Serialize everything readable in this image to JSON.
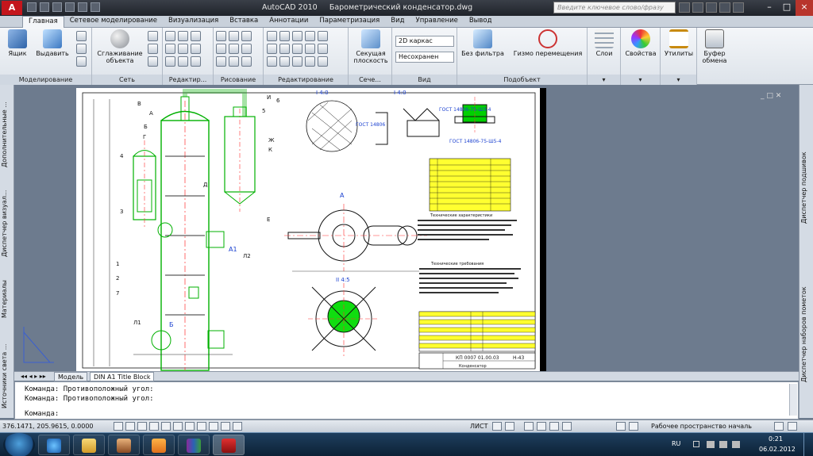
{
  "titlebar": {
    "logo": "A",
    "app": "AutoCAD 2010",
    "file": "Барометрический конденсатор.dwg",
    "search_placeholder": "Введите ключевое слово/фразу"
  },
  "tabs": [
    "Главная",
    "Сетевое моделирование",
    "Визуализация",
    "Вставка",
    "Аннотации",
    "Параметризация",
    "Вид",
    "Управление",
    "Вывод"
  ],
  "ribbon": {
    "buttons": {
      "box": "Ящик",
      "extrude": "Выдавить",
      "smooth1": "Сглаживание",
      "smooth2": "объекта",
      "section1": "Секущая",
      "section2": "плоскость",
      "nofilter": "Без фильтра",
      "gizmo": "Гизмо перемещения",
      "layers": "Слои",
      "properties": "Свойства",
      "utilities": "Утилиты",
      "clipboard1": "Буфер",
      "clipboard2": "обмена"
    },
    "combos": {
      "visual_style": "2D каркас",
      "view": "Несохранен"
    },
    "panels": [
      "Моделирование",
      "Сеть",
      "Редактир...",
      "Рисование",
      "Редактирование",
      "Сече...",
      "Вид",
      "Подобъект"
    ]
  },
  "left_palette": [
    "Дополнительные ...",
    "Диспетчер визуал...",
    "Материалы",
    "Источники света ..."
  ],
  "right_palette": [
    "Диспетчер подшивок",
    "Диспетчер наборов пометок"
  ],
  "layout_tabs": [
    "Модель",
    "DIN A1 Title Block"
  ],
  "command_lines": [
    "Команда: Противоположный угол:",
    "Команда: Противоположный угол:"
  ],
  "command_prompt": "Команда:",
  "status": {
    "coords": "376.1471, 205.9615, 0.0000",
    "sheet": "ЛИСТ",
    "workspace": "Рабочее пространство началь"
  },
  "drawing": {
    "view_top": "I 4:0",
    "view_mid": "I 4:0",
    "view_bottom": "II 4:5",
    "gost1": "ГОСТ 14806",
    "gost2": "ГОСТ 14806-75-Ш3-4",
    "gost3": "ГОСТ 14806-75-Ш5-4",
    "section_a": "А",
    "section_b": "Б",
    "label_a1": "А1",
    "label_a2": "А2",
    "label_l1": "Л1",
    "label_l2": "Л2",
    "labels_vessel": [
      "В",
      "А",
      "Б",
      "Г",
      "Д",
      "Е",
      "Ж",
      "И",
      "К"
    ],
    "numbers": [
      "1",
      "2",
      "3",
      "4",
      "5",
      "6",
      "7"
    ],
    "notes_title": "Технические характеристики",
    "req_title": "Технические требования",
    "stamp_code": "КП 0007 01.00.03",
    "stamp_sheet": "Н-43",
    "stamp_name": "Конденсатор"
  },
  "taskbar": {
    "lang": "RU",
    "time": "0:21",
    "date": "06.02.2012"
  },
  "colors": {
    "drawing_bg": "#000000",
    "vessel": "#00c800",
    "dim": "#ffffff",
    "hatch": "#00e000",
    "centerline": "#ff3030",
    "table": "#ffff00"
  }
}
